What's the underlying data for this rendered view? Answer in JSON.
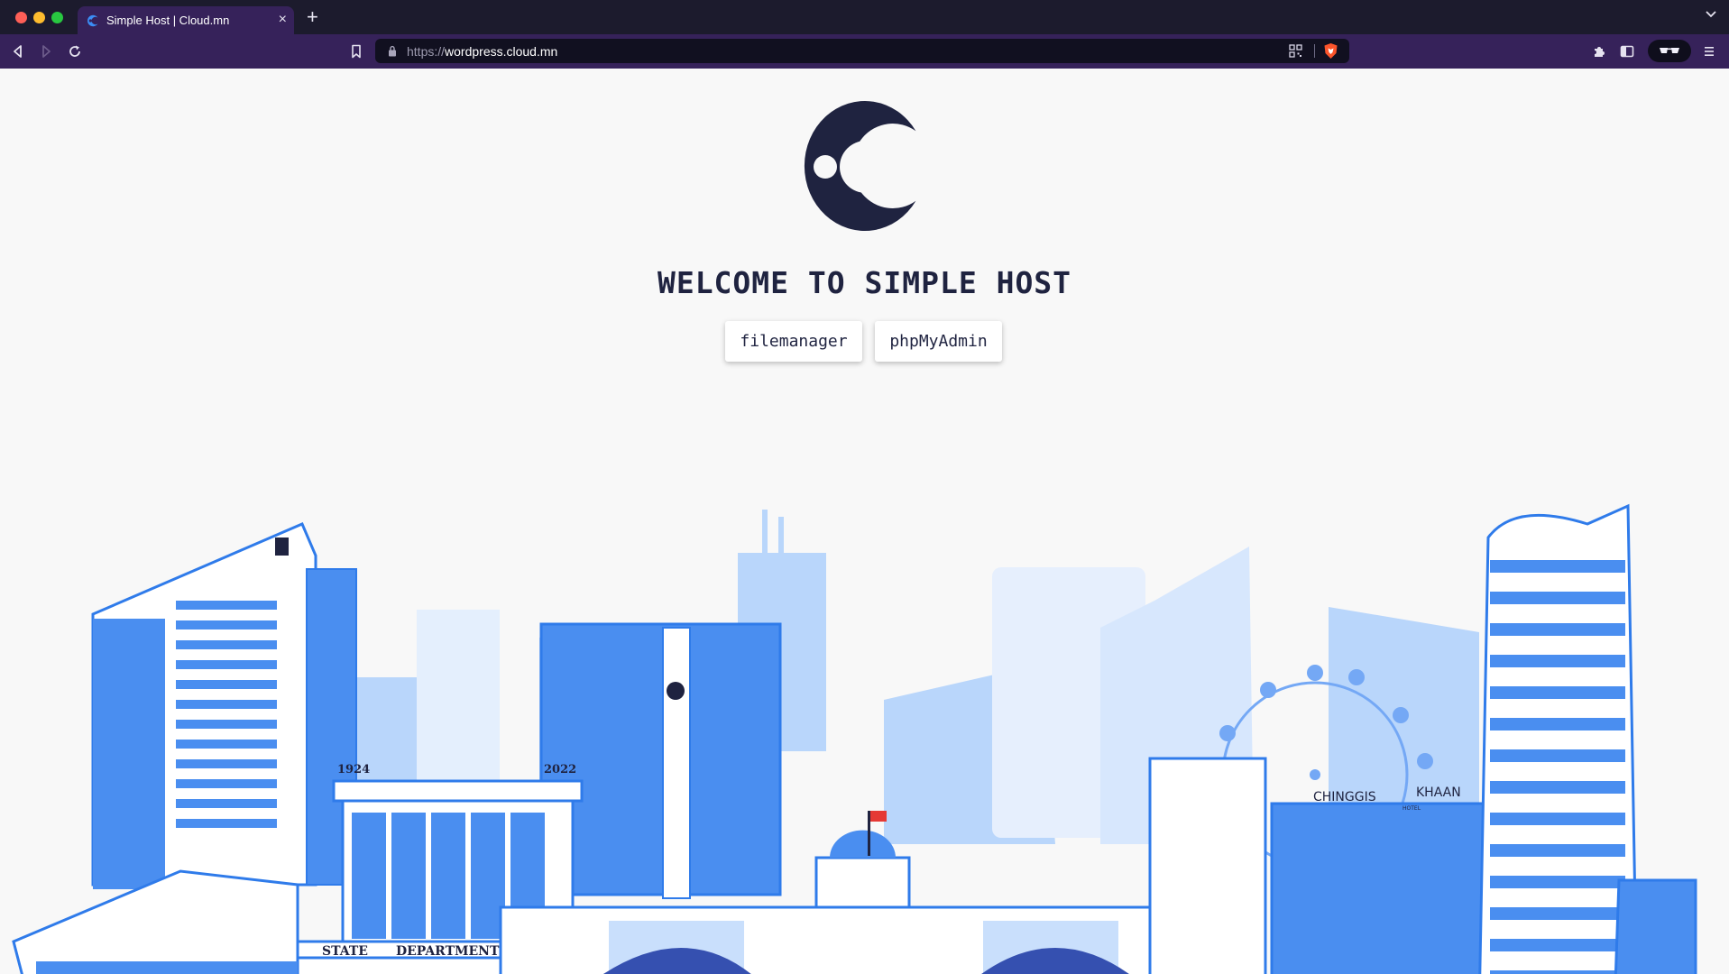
{
  "browser": {
    "tab": {
      "title": "Simple Host | Cloud.mn",
      "close_glyph": "×"
    },
    "new_tab_glyph": "+",
    "url": {
      "scheme": "https://",
      "host": "wordpress.cloud.mn"
    },
    "icons": [
      "back-icon",
      "forward-icon",
      "reload-icon",
      "bookmark-icon",
      "lock-icon",
      "qr-code-icon",
      "brave-shield-icon",
      "extensions-icon",
      "sidebar-icon",
      "private-glasses-icon",
      "menu-icon",
      "tab-list-chevron-icon"
    ]
  },
  "page": {
    "welcome": "WELCOME TO SIMPLE HOST",
    "buttons": {
      "filemanager": "filemanager",
      "phpmyadmin": "phpMyAdmin"
    },
    "skyline": {
      "year_left": "1924",
      "year_right": "2022",
      "state_label": "STATE",
      "department_label": "DEPARTMENT",
      "hotel_name_left": "CHINGGIS",
      "hotel_name_right": "KHAAN",
      "hotel_sub": "HOTEL"
    }
  },
  "colors": {
    "brand_dark": "#1f2340",
    "accent_blue": "#2f7bea",
    "light_blue": "#b9d6fb",
    "chrome_purple": "#36225a"
  }
}
